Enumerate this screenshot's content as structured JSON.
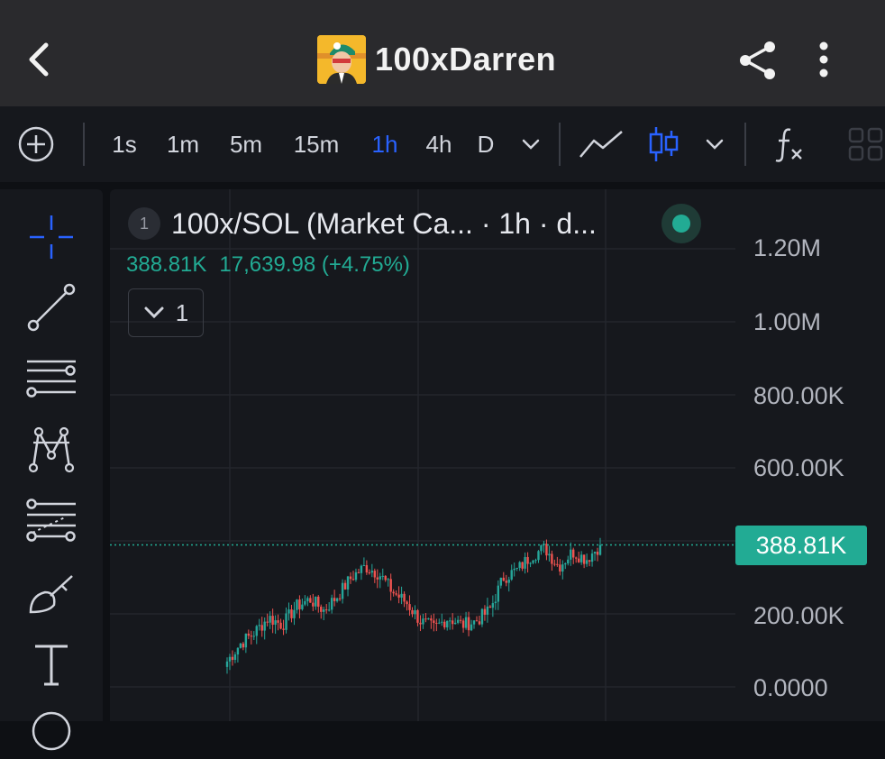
{
  "header": {
    "title": "100xDarren",
    "back_icon": "chevron-left-icon",
    "share_icon": "share-icon",
    "more_icon": "more-vertical-icon"
  },
  "toolbar": {
    "add_icon": "plus-circle-icon",
    "intervals": [
      "1s",
      "1m",
      "5m",
      "15m",
      "1h",
      "4h",
      "D"
    ],
    "active_interval": "1h",
    "interval_dropdown_icon": "chevron-down-icon",
    "line_chart_icon": "line-chart-icon",
    "candles_icon": "candlestick-icon",
    "chart_type_dropdown_icon": "chevron-down-icon",
    "indicators_icon": "fx-icon",
    "layout_icon": "grid-layout-icon"
  },
  "left_tools": [
    "crosshair-icon",
    "trend-line-icon",
    "horizontal-lines-icon",
    "pattern-icon",
    "fib-levels-icon",
    "brush-icon",
    "text-icon"
  ],
  "legend": {
    "index": "1",
    "title": "100x/SOL (Market Ca...  · 1h · d...",
    "status_color": "#22ab94",
    "last_value": "388.81K",
    "change": "17,639.98 (+4.75%)",
    "collapse_count": "1"
  },
  "yaxis": {
    "labels": [
      "1.20M",
      "1.00M",
      "800.00K",
      "600.00K",
      "200.00K",
      "0.0000"
    ],
    "current_price": "388.81K"
  },
  "colors": {
    "up": "#26a69a",
    "down": "#ef5350",
    "accent": "#2962ff",
    "badge": "#22ab94"
  },
  "chart_data": {
    "type": "candlestick",
    "unit": "market cap",
    "ylim": [
      0,
      1300000
    ],
    "last": 388810,
    "approx_close_trend": [
      70000,
      120000,
      150000,
      190000,
      170000,
      220000,
      240000,
      210000,
      250000,
      300000,
      330000,
      310000,
      260000,
      230000,
      180000,
      160000,
      190000,
      170000,
      180000,
      210000,
      300000,
      320000,
      360000,
      380000,
      330000,
      370000,
      350000,
      388810
    ]
  }
}
